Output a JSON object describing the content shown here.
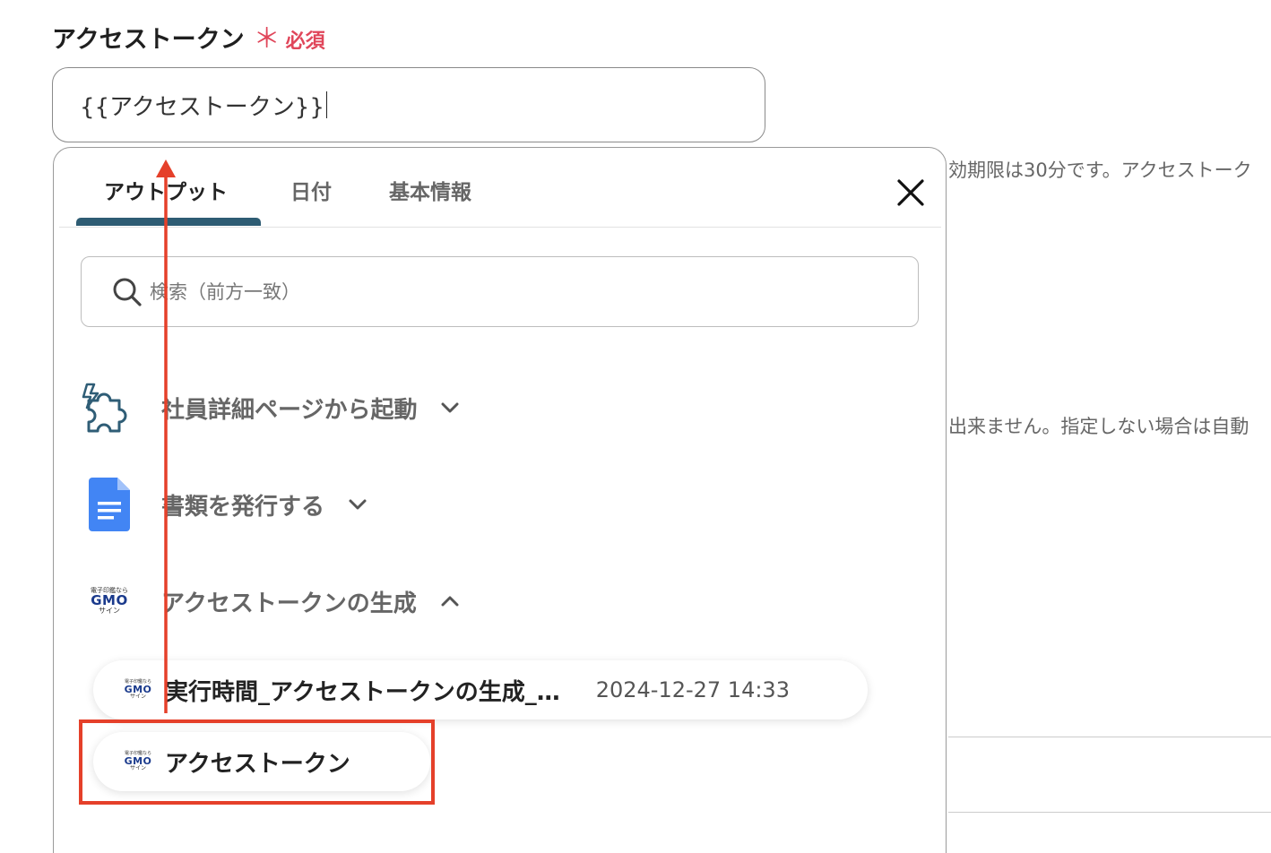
{
  "field": {
    "label": "アクセストークン",
    "required_mark": "＊",
    "required_text": "必須",
    "value": "{{アクセストークン}}"
  },
  "background": {
    "text1": "効期限は30分です。アクセストーク",
    "text2": "出来ません。指定しない場合は自動"
  },
  "popup": {
    "tabs": [
      {
        "label": "アウトプット",
        "active": true
      },
      {
        "label": "日付",
        "active": false
      },
      {
        "label": "基本情報",
        "active": false
      }
    ],
    "search": {
      "placeholder": "検索（前方一致）"
    },
    "sections": [
      {
        "label": "社員詳細ページから起動",
        "icon": "puzzle-icon",
        "expanded": false
      },
      {
        "label": "書類を発行する",
        "icon": "google-docs-icon",
        "expanded": false
      },
      {
        "label": "アクセストークンの生成",
        "icon": "gmo-sign-logo",
        "expanded": true
      }
    ],
    "items": [
      {
        "name": "実行時間_アクセストークンの生成_…",
        "time": "2024-12-27 14:33"
      },
      {
        "name": "アクセストークン"
      }
    ]
  },
  "logo": {
    "top": "電子印鑑なら",
    "mid": "GMO",
    "bottom": "サイン"
  },
  "colors": {
    "required": "#e0465a",
    "tab_underline": "#2e5c73",
    "highlight": "#e5402a",
    "docs_blue": "#4285f4"
  }
}
